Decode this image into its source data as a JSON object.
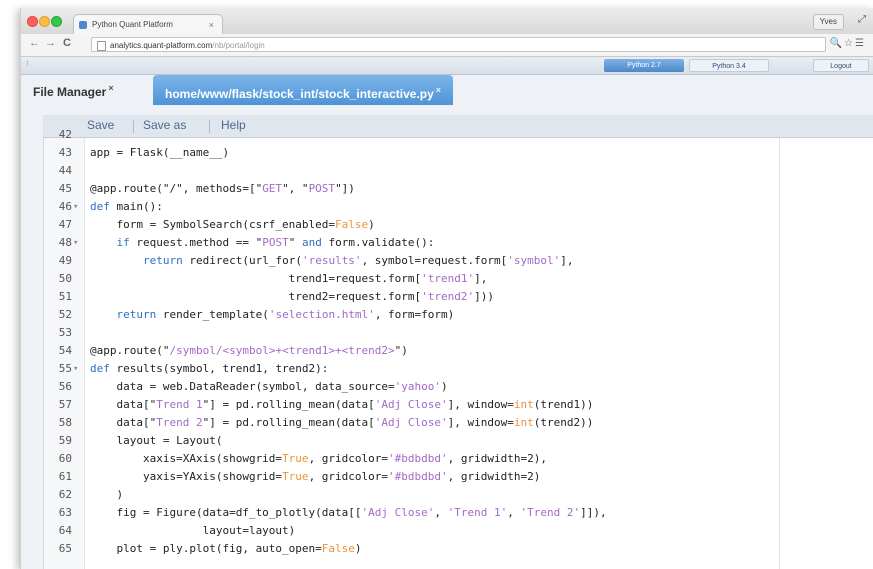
{
  "browser": {
    "tab_title": "Python Quant Platform",
    "tab_close": "×",
    "user_button": "Yves",
    "resize_glyph": "⤢",
    "nav_back": "←",
    "nav_forward": "→",
    "nav_reload": "C",
    "url_host": "analytics.quant-platform.com",
    "url_path": "/nb/portal/login",
    "address_icons": "🔍☆☰"
  },
  "kernel_bar": {
    "left_mark": "⁝",
    "python27": "Python 2.7",
    "python34": "Python 3.4",
    "logout": "Logout"
  },
  "file_tabs": {
    "file_manager": "File Manager",
    "close_mark": "×",
    "active_file": "home/www/flask/stock_int/stock_interactive.py",
    "active_close": "×"
  },
  "toolbar": {
    "save": "Save",
    "save_as": "Save as",
    "help": "Help"
  },
  "code_lines": [
    {
      "n": "42",
      "fold": "",
      "segments": [
        {
          "t": ""
        }
      ]
    },
    {
      "n": "43",
      "fold": "",
      "segments": [
        {
          "t": "app = Flask(__name__)"
        }
      ]
    },
    {
      "n": "44",
      "fold": "",
      "segments": [
        {
          "t": ""
        }
      ]
    },
    {
      "n": "45",
      "fold": "",
      "segments": [
        {
          "t": "@app.route(\"/\", methods=[\""
        },
        {
          "t": "GET",
          "c": "s"
        },
        {
          "t": "\", \""
        },
        {
          "t": "POST",
          "c": "s"
        },
        {
          "t": "\"])"
        }
      ]
    },
    {
      "n": "46",
      "fold": "▾",
      "segments": [
        {
          "t": "def",
          "c": "k"
        },
        {
          "t": " main():"
        }
      ]
    },
    {
      "n": "47",
      "fold": "",
      "segments": [
        {
          "t": "    form = SymbolSearch(csrf_enabled="
        },
        {
          "t": "False",
          "c": "b"
        },
        {
          "t": ")"
        }
      ]
    },
    {
      "n": "48",
      "fold": "▾",
      "segments": [
        {
          "t": "    "
        },
        {
          "t": "if",
          "c": "k"
        },
        {
          "t": " request.method == \""
        },
        {
          "t": "POST",
          "c": "s"
        },
        {
          "t": "\" "
        },
        {
          "t": "and",
          "c": "o"
        },
        {
          "t": " form.validate():"
        }
      ]
    },
    {
      "n": "49",
      "fold": "",
      "segments": [
        {
          "t": "        "
        },
        {
          "t": "return",
          "c": "k"
        },
        {
          "t": " redirect(url_for("
        },
        {
          "t": "'results'",
          "c": "s"
        },
        {
          "t": ", symbol=request.form["
        },
        {
          "t": "'symbol'",
          "c": "s"
        },
        {
          "t": "],"
        }
      ]
    },
    {
      "n": "50",
      "fold": "",
      "segments": [
        {
          "t": "                              trend1=request.form["
        },
        {
          "t": "'trend1'",
          "c": "s"
        },
        {
          "t": "],"
        }
      ]
    },
    {
      "n": "51",
      "fold": "",
      "segments": [
        {
          "t": "                              trend2=request.form["
        },
        {
          "t": "'trend2'",
          "c": "s"
        },
        {
          "t": "]))"
        }
      ]
    },
    {
      "n": "52",
      "fold": "",
      "segments": [
        {
          "t": "    "
        },
        {
          "t": "return",
          "c": "k"
        },
        {
          "t": " render_template("
        },
        {
          "t": "'selection.html'",
          "c": "s"
        },
        {
          "t": ", form=form)"
        }
      ]
    },
    {
      "n": "53",
      "fold": "",
      "segments": [
        {
          "t": ""
        }
      ]
    },
    {
      "n": "54",
      "fold": "",
      "segments": [
        {
          "t": "@app.route(\""
        },
        {
          "t": "/symbol/<symbol>+<trend1>+<trend2>",
          "c": "s"
        },
        {
          "t": "\")"
        }
      ]
    },
    {
      "n": "55",
      "fold": "▾",
      "segments": [
        {
          "t": "def",
          "c": "k"
        },
        {
          "t": " results(symbol, trend1, trend2):"
        }
      ]
    },
    {
      "n": "56",
      "fold": "",
      "segments": [
        {
          "t": "    data = web.DataReader(symbol, data_source="
        },
        {
          "t": "'yahoo'",
          "c": "s"
        },
        {
          "t": ")"
        }
      ]
    },
    {
      "n": "57",
      "fold": "",
      "segments": [
        {
          "t": "    data[\""
        },
        {
          "t": "Trend 1",
          "c": "s"
        },
        {
          "t": "\"] = pd.rolling_mean(data["
        },
        {
          "t": "'Adj Close'",
          "c": "s"
        },
        {
          "t": "], window="
        },
        {
          "t": "int",
          "c": "b"
        },
        {
          "t": "(trend1))"
        }
      ]
    },
    {
      "n": "58",
      "fold": "",
      "segments": [
        {
          "t": "    data[\""
        },
        {
          "t": "Trend 2",
          "c": "s"
        },
        {
          "t": "\"] = pd.rolling_mean(data["
        },
        {
          "t": "'Adj Close'",
          "c": "s"
        },
        {
          "t": "], window="
        },
        {
          "t": "int",
          "c": "b"
        },
        {
          "t": "(trend2))"
        }
      ]
    },
    {
      "n": "59",
      "fold": "",
      "segments": [
        {
          "t": "    layout = Layout("
        }
      ]
    },
    {
      "n": "60",
      "fold": "",
      "segments": [
        {
          "t": "        xaxis=XAxis(showgrid="
        },
        {
          "t": "True",
          "c": "b"
        },
        {
          "t": ", gridcolor="
        },
        {
          "t": "'#bdbdbd'",
          "c": "s"
        },
        {
          "t": ", gridwidth=2),"
        }
      ]
    },
    {
      "n": "61",
      "fold": "",
      "segments": [
        {
          "t": "        yaxis=YAxis(showgrid="
        },
        {
          "t": "True",
          "c": "b"
        },
        {
          "t": ", gridcolor="
        },
        {
          "t": "'#bdbdbd'",
          "c": "s"
        },
        {
          "t": ", gridwidth=2)"
        }
      ]
    },
    {
      "n": "62",
      "fold": "",
      "segments": [
        {
          "t": "    )"
        }
      ]
    },
    {
      "n": "63",
      "fold": "",
      "segments": [
        {
          "t": "    fig = Figure(data=df_to_plotly(data[["
        },
        {
          "t": "'Adj Close'",
          "c": "s"
        },
        {
          "t": ", "
        },
        {
          "t": "'Trend 1'",
          "c": "s"
        },
        {
          "t": ", "
        },
        {
          "t": "'Trend 2'",
          "c": "s"
        },
        {
          "t": "]]),"
        }
      ]
    },
    {
      "n": "64",
      "fold": "",
      "segments": [
        {
          "t": "                 layout=layout)"
        }
      ]
    },
    {
      "n": "65",
      "fold": "",
      "segments": [
        {
          "t": "    plot = ply.plot(fig, auto_open="
        },
        {
          "t": "False",
          "c": "b"
        },
        {
          "t": ")"
        }
      ]
    }
  ],
  "colors": {
    "accent": "#4f93d6",
    "string": "#a36ac7",
    "keyword": "#2f6fc1",
    "builtin": "#e8943a"
  }
}
